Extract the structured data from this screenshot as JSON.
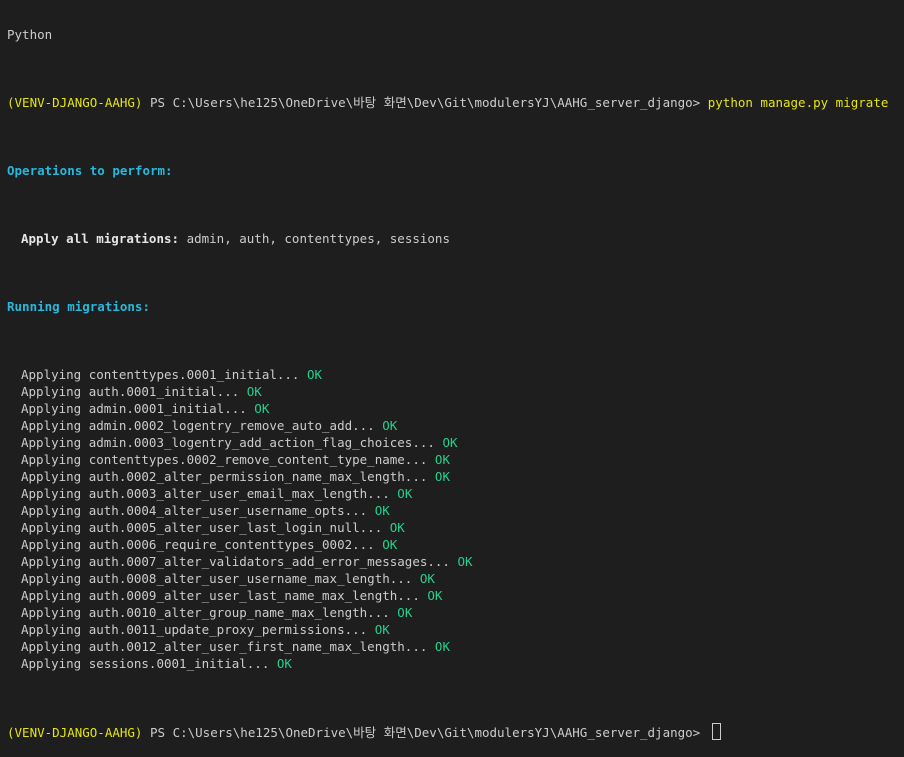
{
  "terminal": {
    "title_line": "Python",
    "prompt": {
      "venv": "(VENV-DJANGO-AAHG)",
      "path": " PS C:\\Users\\he125\\OneDrive\\바탕 화면\\Dev\\Git\\modulersYJ\\AAHG_server_django> ",
      "command": "python manage.py migrate"
    },
    "ops_header": "Operations to perform:",
    "apply_all_label": "Apply all migrations:",
    "apply_all_apps": " admin, auth, contenttypes, sessions",
    "running_header": "Running migrations:",
    "ok_label": "OK",
    "migrations": [
      "Applying contenttypes.0001_initial... ",
      "Applying auth.0001_initial... ",
      "Applying admin.0001_initial... ",
      "Applying admin.0002_logentry_remove_auto_add... ",
      "Applying admin.0003_logentry_add_action_flag_choices... ",
      "Applying contenttypes.0002_remove_content_type_name... ",
      "Applying auth.0002_alter_permission_name_max_length... ",
      "Applying auth.0003_alter_user_email_max_length... ",
      "Applying auth.0004_alter_user_username_opts... ",
      "Applying auth.0005_alter_user_last_login_null... ",
      "Applying auth.0006_require_contenttypes_0002... ",
      "Applying auth.0007_alter_validators_add_error_messages... ",
      "Applying auth.0008_alter_user_username_max_length... ",
      "Applying auth.0009_alter_user_last_name_max_length... ",
      "Applying auth.0010_alter_group_name_max_length... ",
      "Applying auth.0011_update_proxy_permissions... ",
      "Applying auth.0012_alter_user_first_name_max_length... ",
      "Applying sessions.0001_initial... "
    ],
    "final_prompt": {
      "venv": "(VENV-DJANGO-AAHG)",
      "path": " PS C:\\Users\\he125\\OneDrive\\바탕 화면\\Dev\\Git\\modulersYJ\\AAHG_server_django> "
    },
    "colors": {
      "background": "#1e1e1e",
      "text": "#cccccc",
      "venv": "#e5e510",
      "header": "#29b8db",
      "ok": "#23d18b"
    }
  }
}
